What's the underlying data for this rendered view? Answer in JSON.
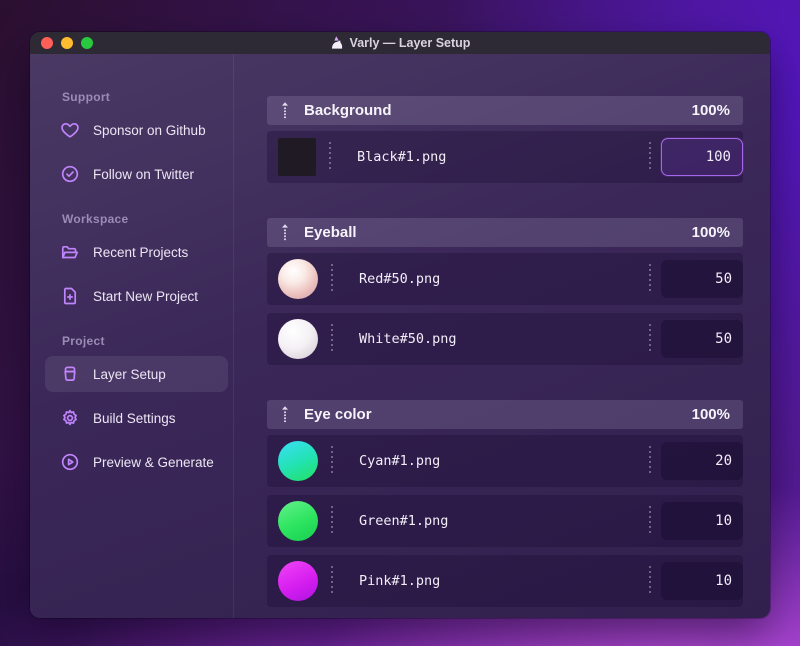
{
  "titlebar": {
    "title": "Varly — Layer Setup",
    "app_icon": "unicorn-icon"
  },
  "sidebar": {
    "sections": [
      {
        "label": "Support",
        "items": [
          {
            "label": "Sponsor on Github",
            "icon": "heart-icon"
          },
          {
            "label": "Follow on Twitter",
            "icon": "check-badge-icon"
          }
        ]
      },
      {
        "label": "Workspace",
        "items": [
          {
            "label": "Recent Projects",
            "icon": "folder-open-icon"
          },
          {
            "label": "Start New Project",
            "icon": "file-plus-icon"
          }
        ]
      },
      {
        "label": "Project",
        "items": [
          {
            "label": "Layer Setup",
            "icon": "archive-box-icon",
            "selected": true
          },
          {
            "label": "Build Settings",
            "icon": "gear-icon"
          },
          {
            "label": "Preview & Generate",
            "icon": "play-circle-icon"
          }
        ]
      }
    ]
  },
  "layers": {
    "groups": [
      {
        "name": "Background",
        "weight": "100%",
        "items": [
          {
            "file": "Black#1.png",
            "value": "100",
            "thumb": "black",
            "focused": true
          }
        ]
      },
      {
        "name": "Eyeball",
        "weight": "100%",
        "items": [
          {
            "file": "Red#50.png",
            "value": "50",
            "thumb": "red"
          },
          {
            "file": "White#50.png",
            "value": "50",
            "thumb": "white"
          }
        ]
      },
      {
        "name": "Eye color",
        "weight": "100%",
        "items": [
          {
            "file": "Cyan#1.png",
            "value": "20",
            "thumb": "cyan"
          },
          {
            "file": "Green#1.png",
            "value": "10",
            "thumb": "green"
          },
          {
            "file": "Pink#1.png",
            "value": "10",
            "thumb": "pink"
          }
        ]
      }
    ]
  },
  "colors": {
    "accent_purple": "#c084fc",
    "focus_border": "#a767ec",
    "traffic_red": "#ff5f57",
    "traffic_yellow": "#febc2e",
    "traffic_green": "#28c840",
    "titlebar_bg": "#2d2935"
  }
}
